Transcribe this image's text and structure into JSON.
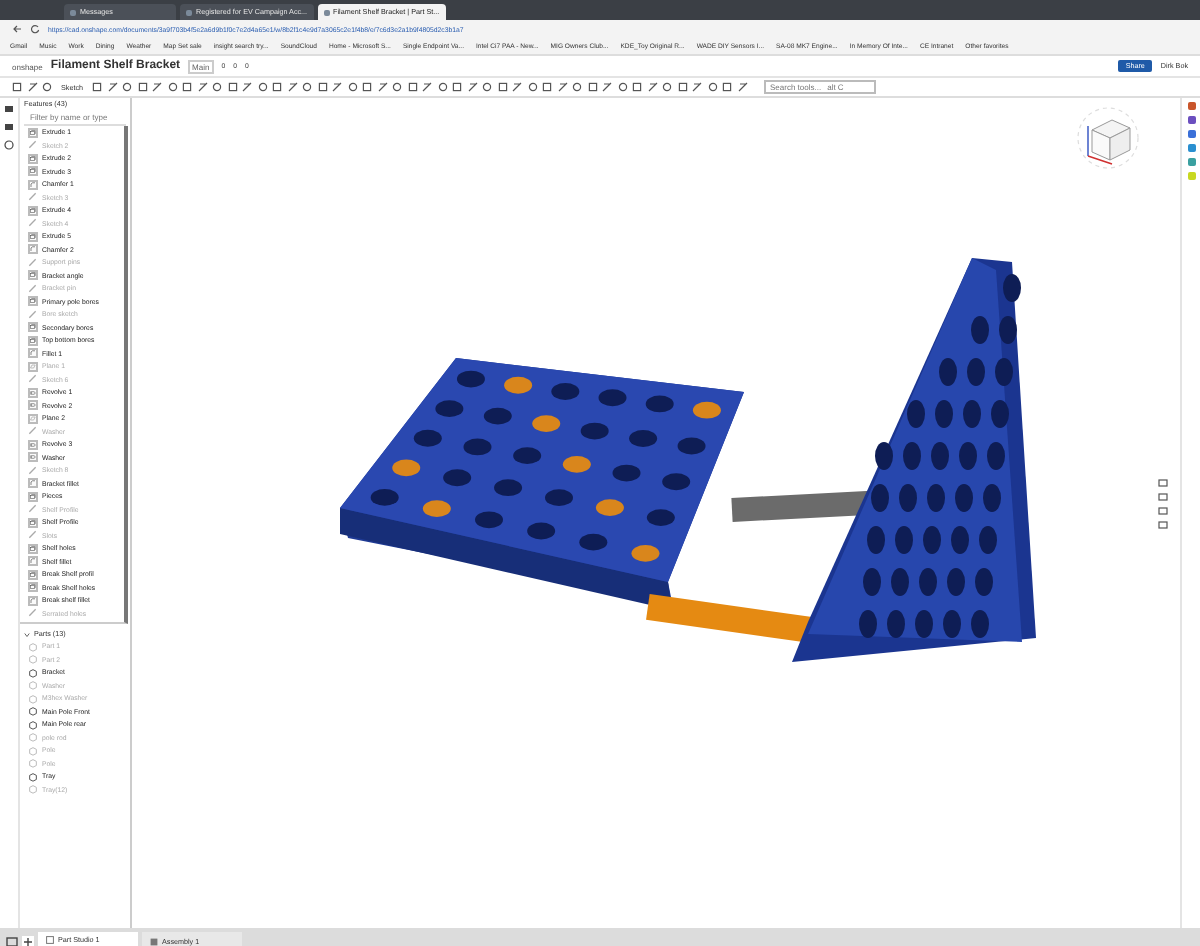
{
  "browser": {
    "tabs": [
      {
        "label": "Messages",
        "selected": false
      },
      {
        "label": "Registered for EV Campaign Acc...",
        "selected": false
      },
      {
        "label": "Filament Shelf Bracket | Part St...",
        "selected": true
      }
    ],
    "url": "https://cad.onshape.com/documents/3a9f703b4f5e2a6d9b1f0c7e2d4a65e1/w/8b2f1c4e9d7a3065c2e1f4b8/e/7c6d3e2a1b9f4805d2c3b1a7",
    "bookmarks": [
      "Gmail",
      "Music",
      "Work",
      "Dining",
      "Weather",
      "Map Set sale",
      "insight search try...",
      "SoundCloud",
      "Home - Microsoft S...",
      "Single Endpoint Va...",
      "Intel Ci7 PAA - New...",
      "MIG Owners Club...",
      "KDE_Toy Original R...",
      "WADE DIY Sensors I...",
      "SA-08 MK7 Engine...",
      "In Memory Of Inte...",
      "CE Intranet",
      "Other favorites"
    ]
  },
  "app": {
    "brand": "onshape",
    "document_title": "Filament Shelf Bracket",
    "branch": "Main",
    "counts": [
      "0",
      "0",
      "0"
    ],
    "sketch_button": "Sketch",
    "search_placeholder": "Search tools...",
    "search_shortcut": "alt C",
    "share": "Share",
    "user": "Dirk Bok"
  },
  "features": {
    "title": "Features (43)",
    "filter_placeholder": "Filter by name or type",
    "items": [
      {
        "label": "Extrude 1",
        "kind": "extrude",
        "hidden": false
      },
      {
        "label": "Sketch 2",
        "kind": "sketch",
        "hidden": true
      },
      {
        "label": "Extrude 2",
        "kind": "extrude",
        "hidden": false
      },
      {
        "label": "Extrude 3",
        "kind": "extrude",
        "hidden": false
      },
      {
        "label": "Chamfer 1",
        "kind": "chamfer",
        "hidden": false
      },
      {
        "label": "Sketch 3",
        "kind": "sketch",
        "hidden": true
      },
      {
        "label": "Extrude 4",
        "kind": "extrude",
        "hidden": false
      },
      {
        "label": "Sketch 4",
        "kind": "sketch",
        "hidden": true
      },
      {
        "label": "Extrude 5",
        "kind": "extrude",
        "hidden": false
      },
      {
        "label": "Chamfer 2",
        "kind": "chamfer",
        "hidden": false
      },
      {
        "label": "Support pins",
        "kind": "sketch",
        "hidden": true
      },
      {
        "label": "Bracket angle",
        "kind": "extrude",
        "hidden": false
      },
      {
        "label": "Bracket pin",
        "kind": "sketch",
        "hidden": true
      },
      {
        "label": "Primary pole bores",
        "kind": "extrude",
        "hidden": false
      },
      {
        "label": "Bore sketch",
        "kind": "sketch",
        "hidden": true
      },
      {
        "label": "Secondary bores",
        "kind": "extrude",
        "hidden": false
      },
      {
        "label": "Top bottom bores",
        "kind": "extrude",
        "hidden": false
      },
      {
        "label": "Fillet 1",
        "kind": "chamfer",
        "hidden": false
      },
      {
        "label": "Plane 1",
        "kind": "plane",
        "hidden": true
      },
      {
        "label": "Sketch 6",
        "kind": "sketch",
        "hidden": true
      },
      {
        "label": "Revolve 1",
        "kind": "revolve",
        "hidden": false
      },
      {
        "label": "Revolve 2",
        "kind": "revolve",
        "hidden": false
      },
      {
        "label": "Plane 2",
        "kind": "plane",
        "hidden": false
      },
      {
        "label": "Washer",
        "kind": "sketch",
        "hidden": true
      },
      {
        "label": "Revolve 3",
        "kind": "revolve",
        "hidden": false
      },
      {
        "label": "Washer",
        "kind": "revolve",
        "hidden": false
      },
      {
        "label": "Sketch 8",
        "kind": "sketch",
        "hidden": true
      },
      {
        "label": "Bracket fillet",
        "kind": "chamfer",
        "hidden": false
      },
      {
        "label": "Pieces",
        "kind": "extrude",
        "hidden": false
      },
      {
        "label": "Shelf Profile",
        "kind": "sketch",
        "hidden": true
      },
      {
        "label": "Shelf Profile",
        "kind": "extrude",
        "hidden": false
      },
      {
        "label": "Slots",
        "kind": "sketch",
        "hidden": true
      },
      {
        "label": "Shelf holes",
        "kind": "extrude",
        "hidden": false
      },
      {
        "label": "Shelf fillet",
        "kind": "chamfer",
        "hidden": false
      },
      {
        "label": "Break Shelf profil",
        "kind": "extrude",
        "hidden": false
      },
      {
        "label": "Break Shelf holes",
        "kind": "extrude",
        "hidden": false
      },
      {
        "label": "Break shelf fillet",
        "kind": "chamfer",
        "hidden": false
      },
      {
        "label": "Serrated holes",
        "kind": "sketch",
        "hidden": true
      }
    ]
  },
  "parts": {
    "title": "Parts (13)",
    "expanded": true,
    "items": [
      {
        "label": "Part 1",
        "hidden": true
      },
      {
        "label": "Part 2",
        "hidden": true
      },
      {
        "label": "Bracket",
        "hidden": false
      },
      {
        "label": "Washer",
        "hidden": true
      },
      {
        "label": "M3hex Washer",
        "hidden": true
      },
      {
        "label": "Main Pole Front",
        "hidden": false
      },
      {
        "label": "Main Pole rear",
        "hidden": false
      },
      {
        "label": "pole rod",
        "hidden": true
      },
      {
        "label": "Pole",
        "hidden": true
      },
      {
        "label": "Pole",
        "hidden": true
      },
      {
        "label": "Tray",
        "hidden": false
      },
      {
        "label": "Tray(12)",
        "hidden": true
      }
    ]
  },
  "bottom_tabs": [
    {
      "label": "Part Studio 1",
      "kind": "partstudio",
      "selected": true
    },
    {
      "label": "Assembly 1",
      "kind": "assembly",
      "selected": false
    }
  ]
}
